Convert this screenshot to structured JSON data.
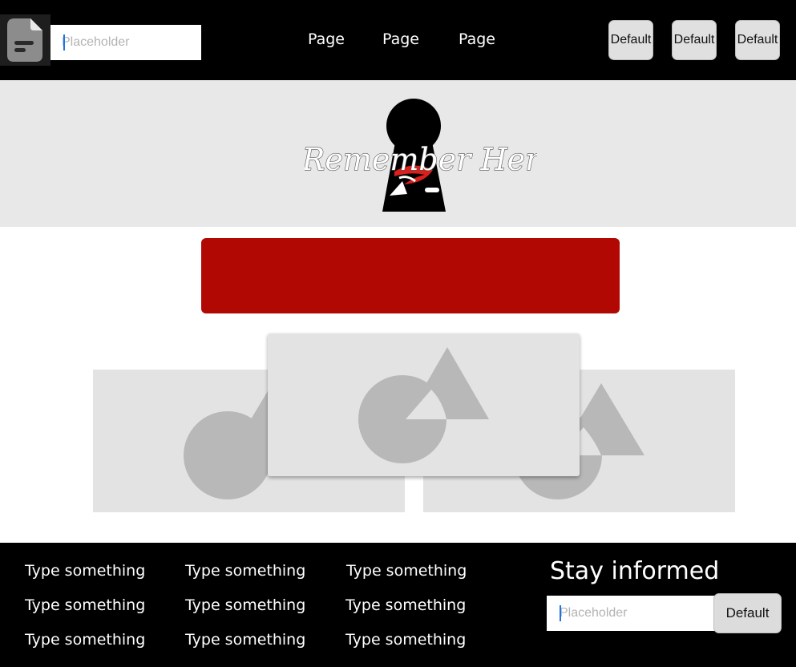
{
  "header": {
    "logo_icon": "document-icon",
    "search_placeholder": "Placeholder",
    "nav": [
      "Page",
      "Page",
      "Page"
    ],
    "buttons": [
      "Default",
      "Default",
      "Default"
    ]
  },
  "hero": {
    "logo_text": "Remember Her",
    "logo_icon": "keyhole-icon"
  },
  "banner": {
    "color": "#b10804"
  },
  "cards": [
    {
      "icon": "image-placeholder-icon"
    },
    {
      "icon": "image-placeholder-icon"
    },
    {
      "icon": "image-placeholder-icon"
    }
  ],
  "footer": {
    "links": [
      [
        "Type something",
        "Type something",
        "Type something"
      ],
      [
        "Type something",
        "Type something",
        "Type something"
      ],
      [
        "Type something",
        "Type something",
        "Type something"
      ]
    ],
    "newsletter_title": "Stay informed",
    "newsletter_placeholder": "Placeholder",
    "newsletter_button": "Default"
  },
  "colors": {
    "header_bg": "#000000",
    "hero_bg": "#e8e8e8",
    "accent_red": "#b10804",
    "placeholder_bg": "#e3e3e3",
    "placeholder_shape": "#b8b8b8"
  }
}
